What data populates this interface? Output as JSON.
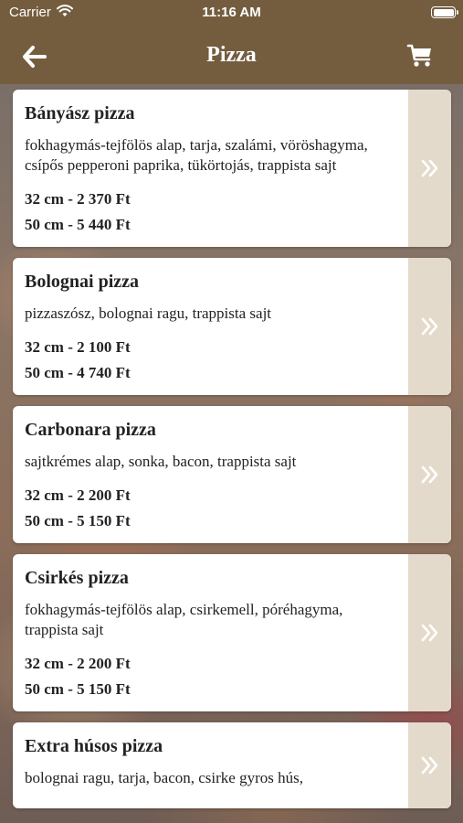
{
  "status": {
    "carrier": "Carrier",
    "time": "11:16 AM"
  },
  "nav": {
    "title": "Pizza"
  },
  "icons": {
    "back": "arrow-left-icon",
    "cart": "cart-icon",
    "chevron": "double-chevron-right-icon",
    "wifi": "wifi-icon",
    "battery": "battery-icon"
  },
  "colors": {
    "header": "#745d3f",
    "card_side": "#e3dacb"
  },
  "items": [
    {
      "name": "Bányász pizza",
      "desc": "fokhagymás-tejfölös alap, tarja, szalámi, vöröshagyma, csípős pepperoni paprika, tükörtojás, trappista sajt",
      "price_small": "32 cm - 2 370 Ft",
      "price_large": "50 cm - 5 440 Ft"
    },
    {
      "name": "Bolognai pizza",
      "desc": "pizzaszósz, bolognai ragu, trappista sajt",
      "price_small": "32 cm - 2 100 Ft",
      "price_large": "50 cm - 4 740 Ft"
    },
    {
      "name": "Carbonara pizza",
      "desc": "sajtkrémes alap, sonka, bacon, trappista sajt",
      "price_small": "32 cm - 2 200 Ft",
      "price_large": "50 cm - 5 150 Ft"
    },
    {
      "name": "Csirkés pizza",
      "desc": "fokhagymás-tejfölös alap, csirkemell, póréhagyma, trappista sajt",
      "price_small": "32 cm - 2 200 Ft",
      "price_large": "50 cm - 5 150 Ft"
    },
    {
      "name": "Extra húsos pizza",
      "desc": "bolognai ragu, tarja, bacon, csirke gyros hús,",
      "price_small": "",
      "price_large": ""
    }
  ]
}
